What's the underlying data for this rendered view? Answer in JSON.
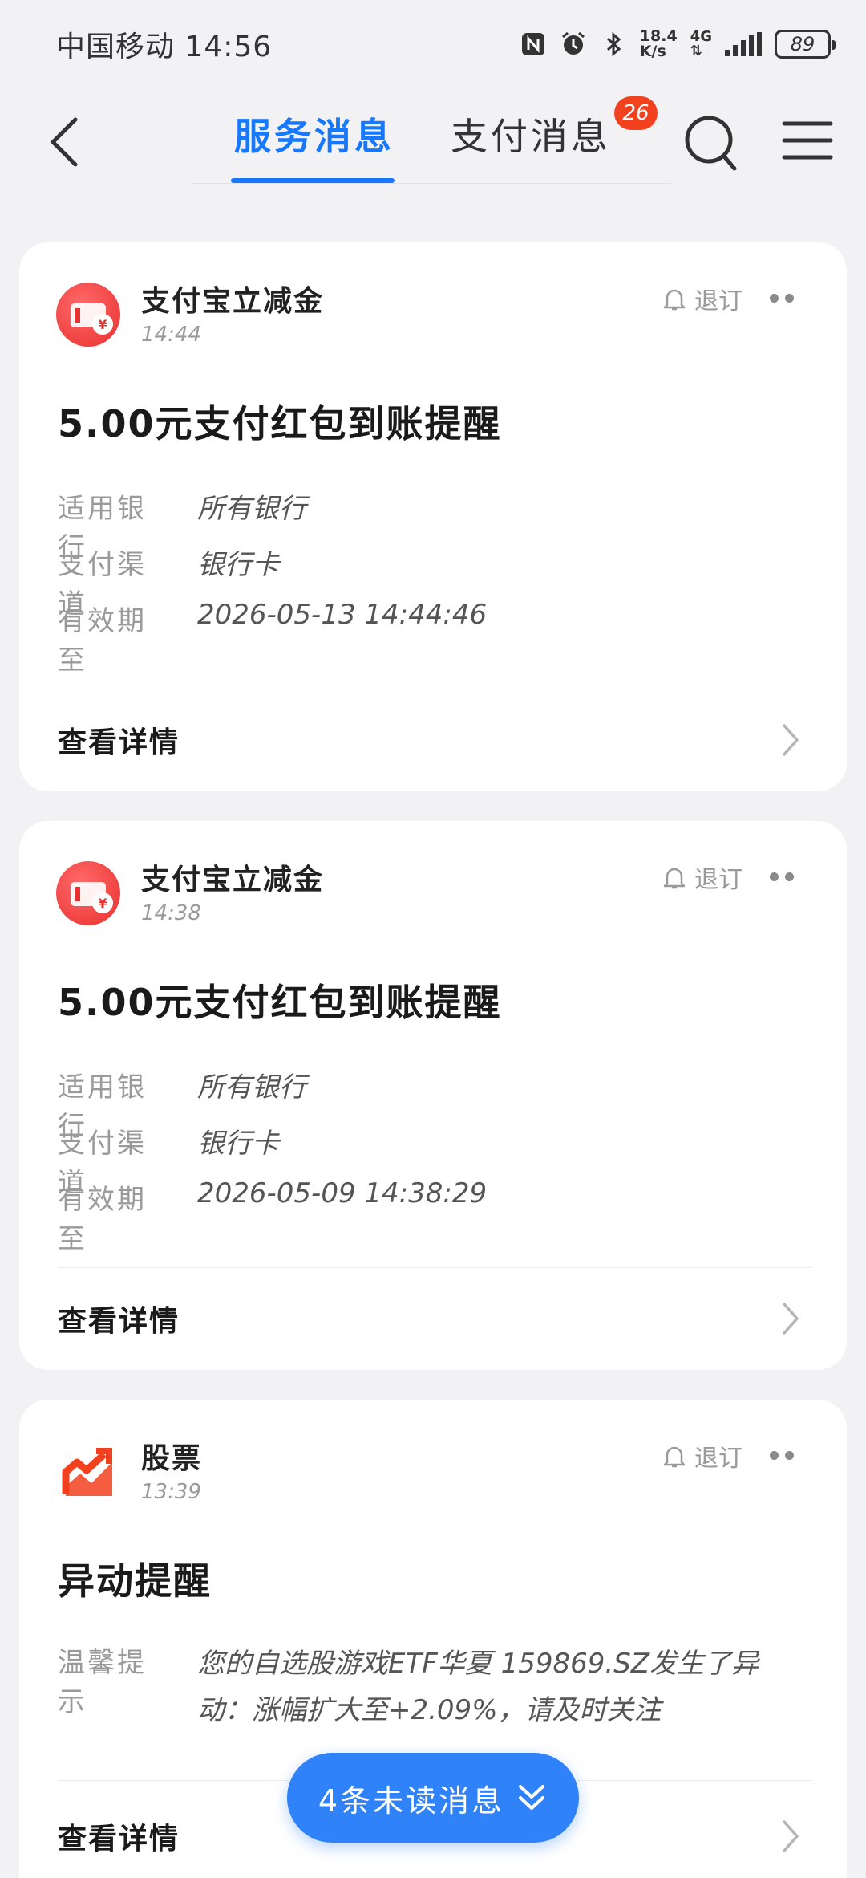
{
  "status_bar": {
    "carrier_time": "中国移动 14:56",
    "speed_value": "18.4",
    "speed_unit": "K/s",
    "network": "4G",
    "battery": "89"
  },
  "header": {
    "tabs": [
      {
        "label": "服务消息",
        "active": true
      },
      {
        "label": "支付消息",
        "active": false
      }
    ],
    "badge_count": "26"
  },
  "cards": [
    {
      "icon": "red-packet-icon",
      "sender": "支付宝立减金",
      "time": "14:44",
      "unsubscribe": "退订",
      "title": "5.00元支付红包到账提醒",
      "fields": [
        {
          "key": "适用银行",
          "value": "所有银行"
        },
        {
          "key": "支付渠道",
          "value": "银行卡"
        },
        {
          "key": "有效期至",
          "value": "2026-05-13 14:44:46"
        }
      ],
      "action": "查看详情"
    },
    {
      "icon": "red-packet-icon",
      "sender": "支付宝立减金",
      "time": "14:38",
      "unsubscribe": "退订",
      "title": "5.00元支付红包到账提醒",
      "fields": [
        {
          "key": "适用银行",
          "value": "所有银行"
        },
        {
          "key": "支付渠道",
          "value": "银行卡"
        },
        {
          "key": "有效期至",
          "value": "2026-05-09 14:38:29"
        }
      ],
      "action": "查看详情"
    },
    {
      "icon": "stock-trend-icon",
      "sender": "股票",
      "time": "13:39",
      "unsubscribe": "退订",
      "title": "异动提醒",
      "fields": [
        {
          "key": "温馨提示",
          "value": "您的自选股游戏ETF华夏 159869.SZ发生了异动：涨幅扩大至+2.09%，请及时关注"
        }
      ],
      "action": "查看详情"
    }
  ],
  "unread_pill": {
    "label": "4条未读消息"
  },
  "colors": {
    "accent": "#1677ff",
    "badge": "#f2411f",
    "pill": "#2f82f7",
    "background": "#f2f2f4"
  }
}
